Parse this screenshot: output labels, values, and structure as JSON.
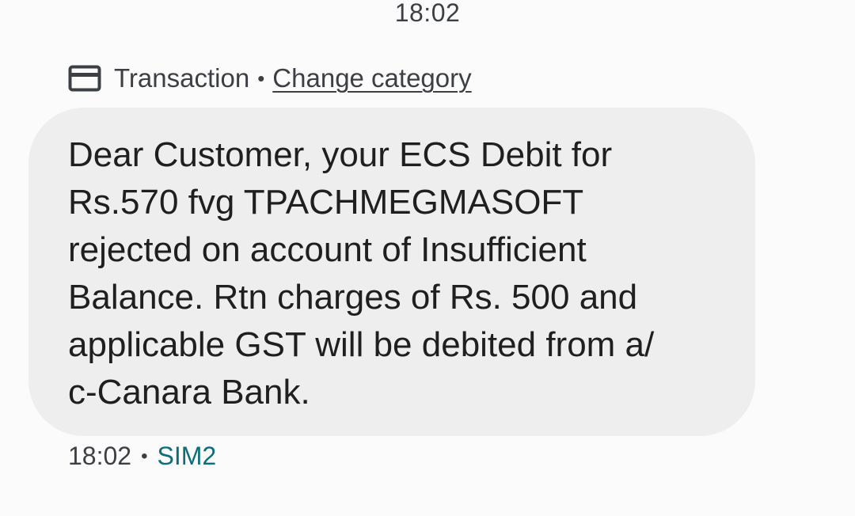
{
  "status_time": "18:02",
  "category": {
    "icon": "credit-card-icon",
    "label": "Transaction",
    "separator": "•",
    "change_link": "Change category"
  },
  "message": {
    "lines": [
      "Dear Customer, your ECS Debit for",
      "Rs.570 fvg TPACHMEGMASOFT",
      "rejected on account of Insufficient",
      "Balance. Rtn charges of Rs. 500 and",
      "applicable GST will be debited from a/",
      "c-Canara Bank."
    ]
  },
  "meta": {
    "time": "18:02",
    "separator": "•",
    "sim": "SIM2"
  },
  "colors": {
    "bubble": "#eeeeee",
    "text": "#1f1f1f",
    "sim_accent": "#0b6e7a"
  }
}
